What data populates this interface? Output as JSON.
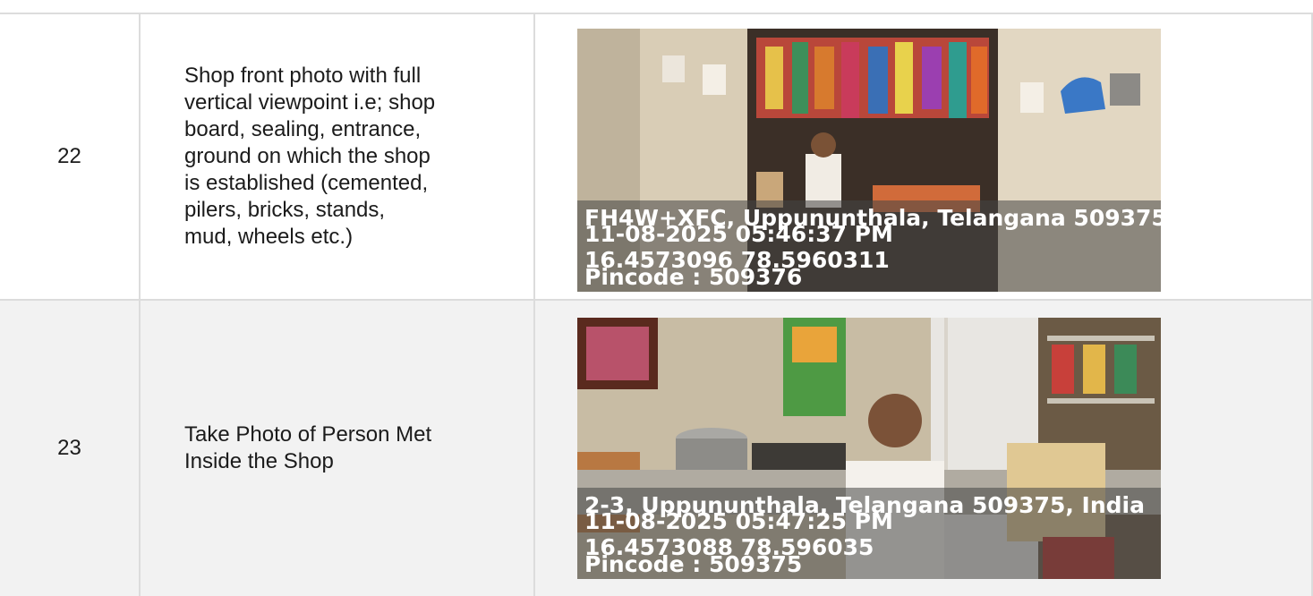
{
  "rows": [
    {
      "number": "22",
      "description": "Shop front photo with full\nvertical viewpoint i.e; shop\nboard, sealing, entrance,\nground on which the shop\nis established (cemented,\npilers, bricks, stands,\nmud, wheels etc.)",
      "photo_overlay": {
        "address": "FH4W+XFC, Uppununthala, Telangana 509375",
        "datetime": "11-08-2025 05:46:37 PM",
        "coordinates": "16.4573096 78.5960311",
        "pincode": "Pincode : 509376"
      }
    },
    {
      "number": "23",
      "description": "Take Photo of Person Met\nInside the Shop",
      "photo_overlay": {
        "address": "2-3, Uppununthala, Telangana 509375, India",
        "datetime": "11-08-2025 05:47:25 PM",
        "coordinates": "16.4573088 78.596035",
        "pincode": "Pincode : 509375"
      }
    }
  ]
}
